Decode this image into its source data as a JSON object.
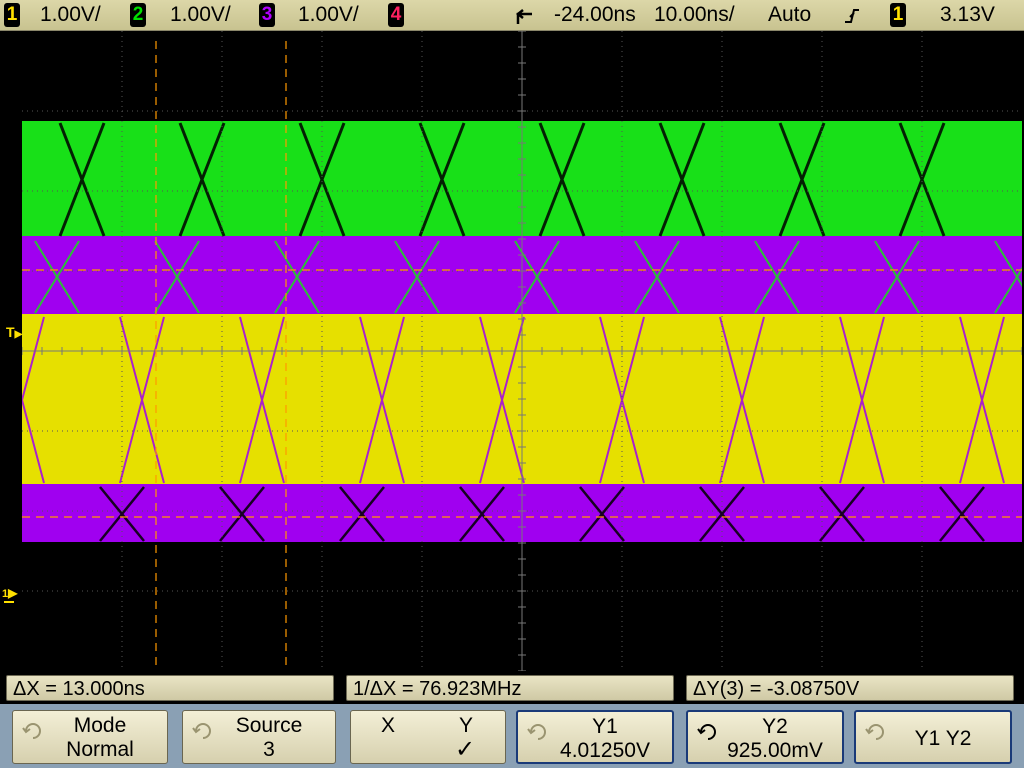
{
  "top": {
    "ch1": {
      "num": "1",
      "scale": "1.00V/",
      "color": "#ffe000"
    },
    "ch2": {
      "num": "2",
      "scale": "1.00V/",
      "color": "#00e000"
    },
    "ch3": {
      "num": "3",
      "scale": "1.00V/",
      "color": "#b000ff"
    },
    "ch4": {
      "num": "4",
      "color": "#ff2060"
    },
    "delay": "-24.00ns",
    "timebase": "10.00ns/",
    "trigger_mode": "Auto",
    "trigger_source": "1",
    "trigger_level": "3.13V"
  },
  "markers": {
    "trigger_level": "T",
    "ch1_ground": "1"
  },
  "measurements": {
    "delta_x": "ΔX = 13.000ns",
    "inv_delta_x": "1/ΔX = 76.923MHz",
    "delta_y": "ΔY(3) = -3.08750V"
  },
  "softkeys": {
    "mode": {
      "l1": "Mode",
      "l2": "Normal"
    },
    "source": {
      "l1": "Source",
      "l2": "3"
    },
    "xy": {
      "x": "X",
      "y": "Y",
      "check": "✓"
    },
    "y1": {
      "l1": "Y1",
      "l2": "4.01250V"
    },
    "y2": {
      "l1": "Y2",
      "l2": "925.00mV"
    },
    "y1y2": {
      "l1": "Y1 Y2"
    }
  },
  "colors": {
    "ch1": "#e8e000",
    "ch2": "#00e000",
    "ch3": "#a000f0",
    "cursor": "#ff9a00",
    "grid": "#606060"
  }
}
